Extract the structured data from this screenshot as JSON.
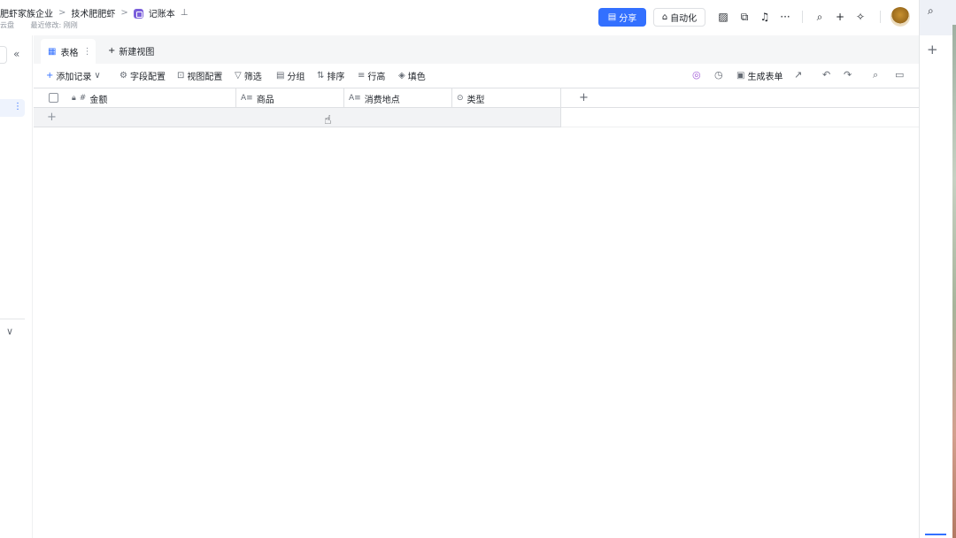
{
  "breadcrumb": {
    "items": [
      "肥虾家族企业",
      "技术肥肥虾",
      "记账本"
    ],
    "separator": ">",
    "sub_left": "云盘",
    "last_modified": "最近修改: 刚刚"
  },
  "header": {
    "share_label": "分享",
    "automation_label": "自动化",
    "more_label": "···"
  },
  "views": {
    "active_tab": "表格",
    "new_view_label": "新建视图"
  },
  "toolbar": {
    "add_record": "添加记录",
    "field_config": "字段配置",
    "view_config": "视图配置",
    "filter": "筛选",
    "group": "分组",
    "sort": "排序",
    "row_height": "行高",
    "fill_color": "填色",
    "generate_form": "生成表单"
  },
  "grid": {
    "columns": [
      {
        "label": "金额",
        "type_icon": "#"
      },
      {
        "label": "商品",
        "type_icon": "A≡"
      },
      {
        "label": "消费地点",
        "type_icon": "A≡"
      },
      {
        "label": "类型",
        "type_icon": "⊙"
      }
    ],
    "rows": []
  },
  "colors": {
    "accent": "#3370ff",
    "doc_icon": "#7b5fdb"
  }
}
